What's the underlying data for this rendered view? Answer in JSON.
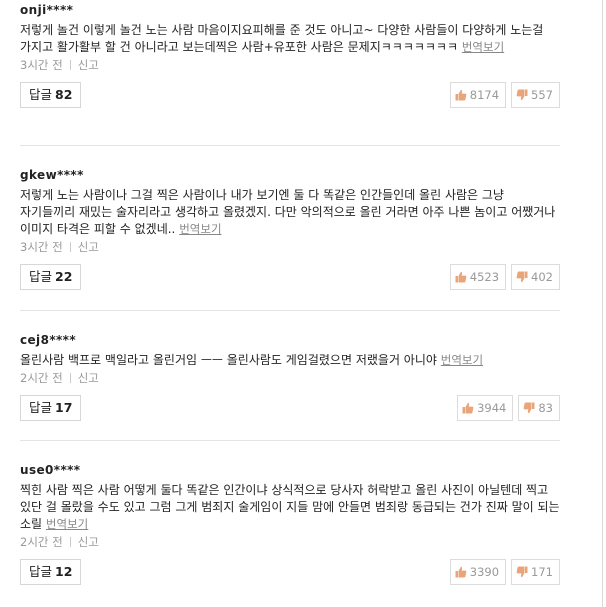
{
  "comments": [
    {
      "user": "onji****",
      "text": "저렇게 놀건 이렇게 놀건 노는 사람 마음이지요피해를 준 것도 아니고~ 다양한 사람들이 다양하게 노는걸 가지고 활가활부 할 건 아니라고 보는데찍은 사람+유포한 사람은 문제지ㅋㅋㅋㅋㅋㅋㅋ",
      "translate": "번역보기",
      "time": "3시간 전",
      "report": "신고",
      "reply_label": "답글",
      "reply_count": "82",
      "likes": "8174",
      "dislikes": "557"
    },
    {
      "user": "gkew****",
      "text": "저렇게 노는 사람이나 그걸 찍은 사람이나 내가 보기엔 둘 다 똑같은 인간들인데 올린 사람은 그냥 자기들끼리 재밌는 술자리라고 생각하고 올렸겠지. 다만 악의적으로 올린 거라면 아주 나쁜 놈이고 어쨌거나 이미지 타격은 피할 수 없겠네..",
      "translate": "번역보기",
      "time": "3시간 전",
      "report": "신고",
      "reply_label": "답글",
      "reply_count": "22",
      "likes": "4523",
      "dislikes": "402"
    },
    {
      "user": "cej8****",
      "text": "올린사람 백프로 맥일라고 올린거임 ㅡㅡ 올린사람도 게임걸렸으면 저랬을거 아니야",
      "translate": "번역보기",
      "time": "2시간 전",
      "report": "신고",
      "reply_label": "답글",
      "reply_count": "17",
      "likes": "3944",
      "dislikes": "83"
    },
    {
      "user": "use0****",
      "text": "찍힌 사람 찍은 사람 어떻게 둘다 똑같은 인간이냐 상식적으로 당사자 허락받고 올린 사진이 아닐텐데 찍고 있단 걸 몰랐을 수도 있고 그럼 그게 범죄지 술게임이 지들 맘에 안들면 범죄랑 동급되는 건가 진짜 말이 되는 소릴",
      "translate": "번역보기",
      "time": "2시간 전",
      "report": "신고",
      "reply_label": "답글",
      "reply_count": "12",
      "likes": "3390",
      "dislikes": "171"
    }
  ],
  "icons": {
    "like": "thumbs-up-icon",
    "dislike": "thumbs-down-icon"
  },
  "colors": {
    "thumb": "#e9a47a",
    "muted": "#999999",
    "border": "#d7d7d7"
  }
}
